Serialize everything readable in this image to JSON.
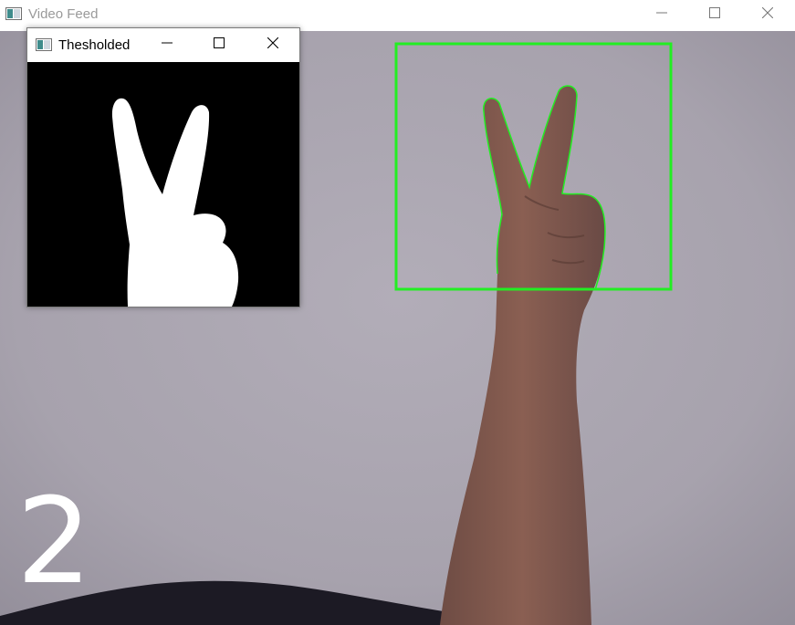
{
  "main_window": {
    "title": "Video Feed",
    "icon": "app-window-icon",
    "controls": [
      "minimize-icon",
      "maximize-icon",
      "close-icon"
    ]
  },
  "child_window": {
    "title": "Thesholded",
    "icon": "app-window-icon",
    "controls": [
      "minimize-icon",
      "maximize-icon",
      "close-icon"
    ]
  },
  "overlay": {
    "finger_count": "2",
    "roi_color": "#22ee22",
    "count_color": "#ffffff"
  },
  "colors": {
    "wall": "#aaa5b0",
    "threshold_background": "#000000",
    "threshold_foreground": "#ffffff"
  }
}
